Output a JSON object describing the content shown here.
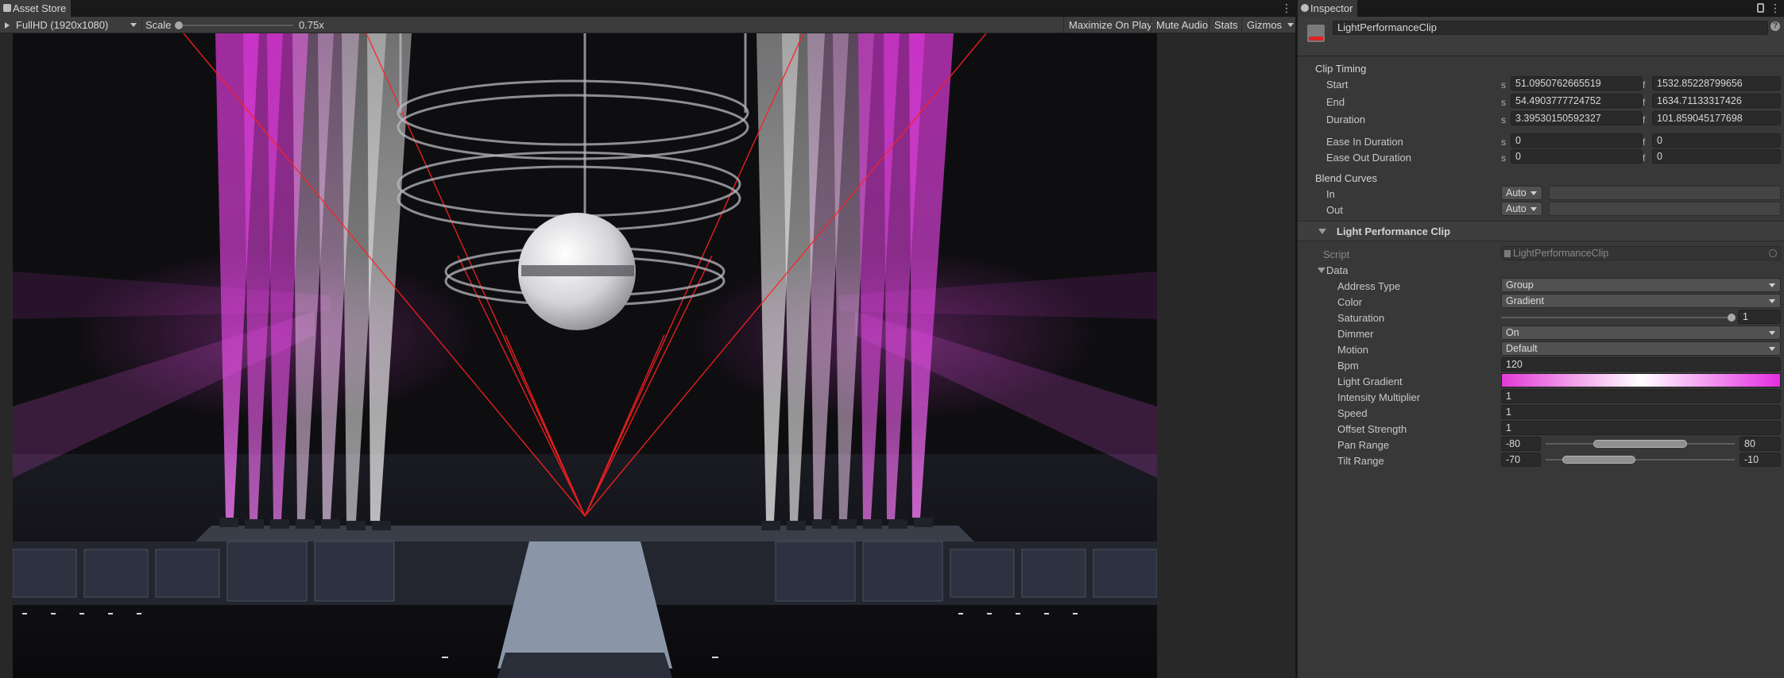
{
  "game_view": {
    "tab_label": "Asset Store",
    "resolution": "FullHD (1920x1080)",
    "scale_label": "Scale",
    "scale_value": "0.75x",
    "maximize_on_play": "Maximize On Play",
    "mute_audio": "Mute Audio",
    "stats": "Stats",
    "gizmos": "Gizmos"
  },
  "inspector": {
    "tab_label": "Inspector",
    "asset_name": "LightPerformanceClip",
    "clip_timing": {
      "header": "Clip Timing",
      "unit_s": "s",
      "unit_f": "f",
      "start_label": "Start",
      "start_s": "51.0950762665519",
      "start_f": "1532.85228799656",
      "end_label": "End",
      "end_s": "54.4903777724752",
      "end_f": "1634.71133317426",
      "duration_label": "Duration",
      "duration_s": "3.39530150592327",
      "duration_f": "101.859045177698",
      "ease_in_label": "Ease In Duration",
      "ease_in_s": "0",
      "ease_in_f": "0",
      "ease_out_label": "Ease Out Duration",
      "ease_out_s": "0",
      "ease_out_f": "0"
    },
    "blend_curves": {
      "header": "Blend Curves",
      "in_label": "In",
      "in_value": "Auto",
      "out_label": "Out",
      "out_value": "Auto"
    },
    "component": {
      "title": "Light Performance Clip",
      "script_label": "Script",
      "script_value": "LightPerformanceClip",
      "data_label": "Data",
      "fields": {
        "address_type_label": "Address Type",
        "address_type_value": "Group",
        "color_label": "Color",
        "color_value": "Gradient",
        "saturation_label": "Saturation",
        "saturation_value": "1",
        "dimmer_label": "Dimmer",
        "dimmer_value": "On",
        "motion_label": "Motion",
        "motion_value": "Default",
        "bpm_label": "Bpm",
        "bpm_value": "120",
        "light_gradient_label": "Light Gradient",
        "light_gradient_colors": [
          "#e23ad6",
          "#ffffff",
          "#e52ce2"
        ],
        "intensity_label": "Intensity Multiplier",
        "intensity_value": "1",
        "speed_label": "Speed",
        "speed_value": "1",
        "offset_label": "Offset Strength",
        "offset_value": "1",
        "pan_range_label": "Pan Range",
        "pan_min": "-80",
        "pan_max": "80",
        "tilt_range_label": "Tilt Range",
        "tilt_min": "-70",
        "tilt_max": "-10"
      }
    }
  },
  "colors": {
    "beam_magenta": "#e43ae0",
    "beam_white": "#ffffff",
    "laser_red": "#ff1a1a",
    "editor_bg": "#383838"
  }
}
